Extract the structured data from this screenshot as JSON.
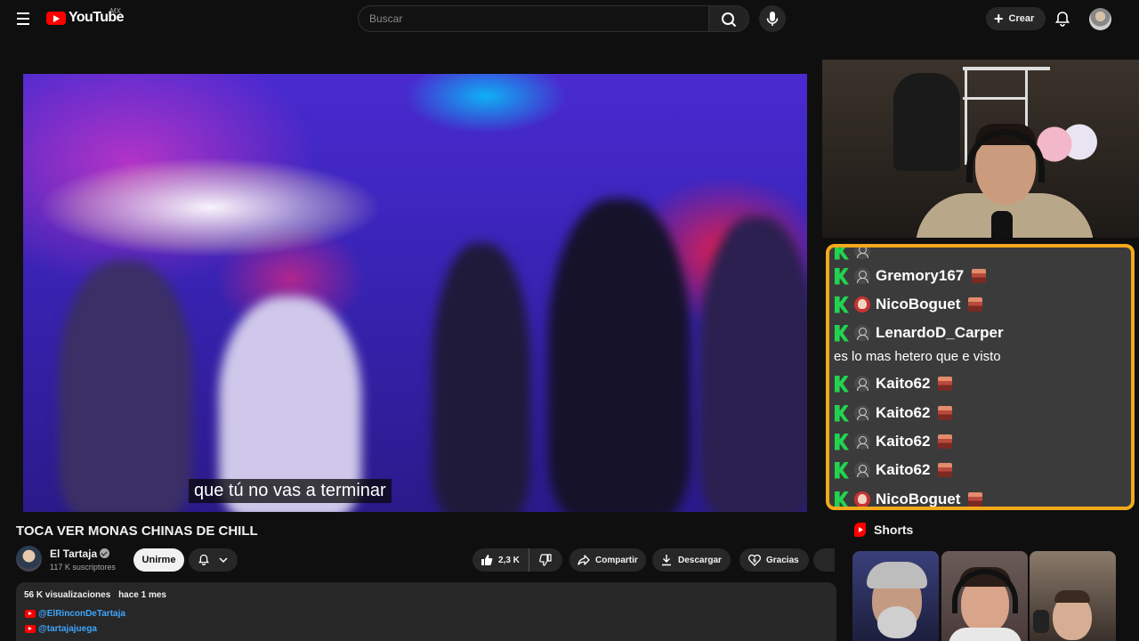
{
  "header": {
    "logo_text": "YouTube",
    "region": "MX",
    "search_placeholder": "Buscar",
    "create_label": "Crear"
  },
  "video": {
    "subtitle": "que tú no vas a terminar",
    "title": "TOCA VER MONAS CHINAS DE CHILL"
  },
  "channel": {
    "name": "El Tartaja",
    "subscribers": "117 K suscriptores",
    "join_label": "Unirme"
  },
  "actions": {
    "likes": "2,3 K",
    "share_label": "Compartir",
    "download_label": "Descargar",
    "thanks_label": "Gracias"
  },
  "description": {
    "views": "56 K visualizaciones",
    "date": "hace 1 mes",
    "links": [
      "@ElRinconDeTartaja",
      "@tartajajuega"
    ]
  },
  "chat": {
    "rows": [
      {
        "type": "user",
        "name": "Gremory167",
        "avatar": "user"
      },
      {
        "type": "user",
        "name": "NicoBoguet",
        "avatar": "skull"
      },
      {
        "type": "user",
        "name": "LenardoD_Carper",
        "avatar": "user"
      },
      {
        "type": "message",
        "text": "es lo mas hetero que e visto"
      },
      {
        "type": "user",
        "name": "Kaito62",
        "avatar": "user"
      },
      {
        "type": "user",
        "name": "Kaito62",
        "avatar": "user"
      },
      {
        "type": "user",
        "name": "Kaito62",
        "avatar": "user"
      },
      {
        "type": "user",
        "name": "Kaito62",
        "avatar": "user"
      },
      {
        "type": "user",
        "name": "NicoBoguet",
        "avatar": "skull"
      }
    ],
    "border_color": "#f2a91b",
    "platform_color": "#22d34f"
  },
  "shorts": {
    "heading": "Shorts"
  },
  "colors": {
    "brand": "#ff0000",
    "link": "#3ea6ff",
    "background": "#0f0f0f"
  }
}
